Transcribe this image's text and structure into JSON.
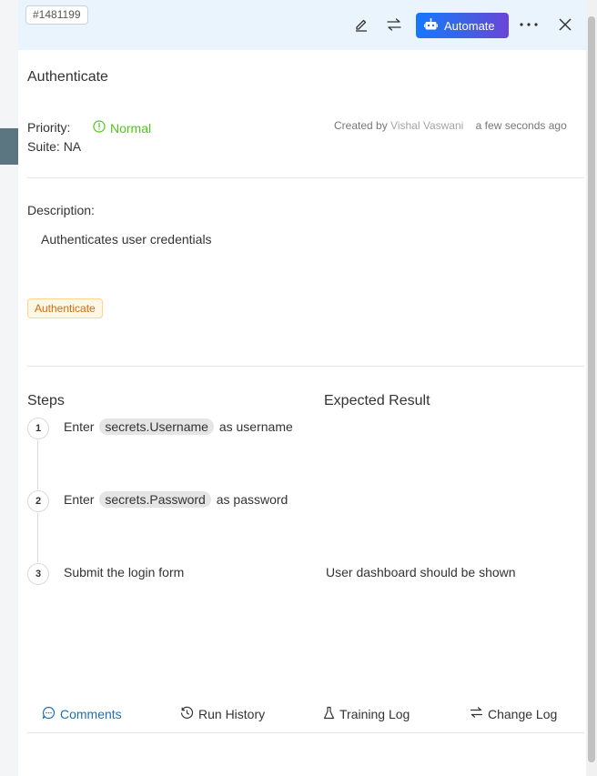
{
  "header": {
    "id": "#1481199",
    "automate_label": "Automate",
    "icons": [
      "edit-icon",
      "swap-icon",
      "robot-icon",
      "more-icon",
      "close-icon"
    ]
  },
  "test_case": {
    "title": "Authenticate",
    "priority_label": "Priority:",
    "priority_value": "Normal",
    "suite": "Suite: NA",
    "created_prefix": "Created by",
    "created_by": "Vishal Vaswani",
    "created_time": "a few seconds ago",
    "description_label": "Description:",
    "description": "Authenticates user credentials",
    "tag": "Authenticate"
  },
  "steps_section": {
    "steps_header": "Steps",
    "expected_header": "Expected Result",
    "steps": [
      {
        "num": "1",
        "pre": "Enter",
        "chip": "secrets.Username",
        "post": "as username",
        "expected": ""
      },
      {
        "num": "2",
        "pre": "Enter",
        "chip": "secrets.Password",
        "post": "as password",
        "expected": ""
      },
      {
        "num": "3",
        "text": "Submit the login form",
        "expected": "User dashboard should be shown"
      }
    ]
  },
  "tabs": [
    {
      "label": "Comments",
      "active": true
    },
    {
      "label": "Run History",
      "active": false
    },
    {
      "label": "Training Log",
      "active": false
    },
    {
      "label": "Change Log",
      "active": false
    }
  ],
  "colors": {
    "header_bg": "#e9f4fd",
    "priority_normal": "#52c41a",
    "tag_text": "#d46b08",
    "active_tab": "#1f6fb5"
  }
}
